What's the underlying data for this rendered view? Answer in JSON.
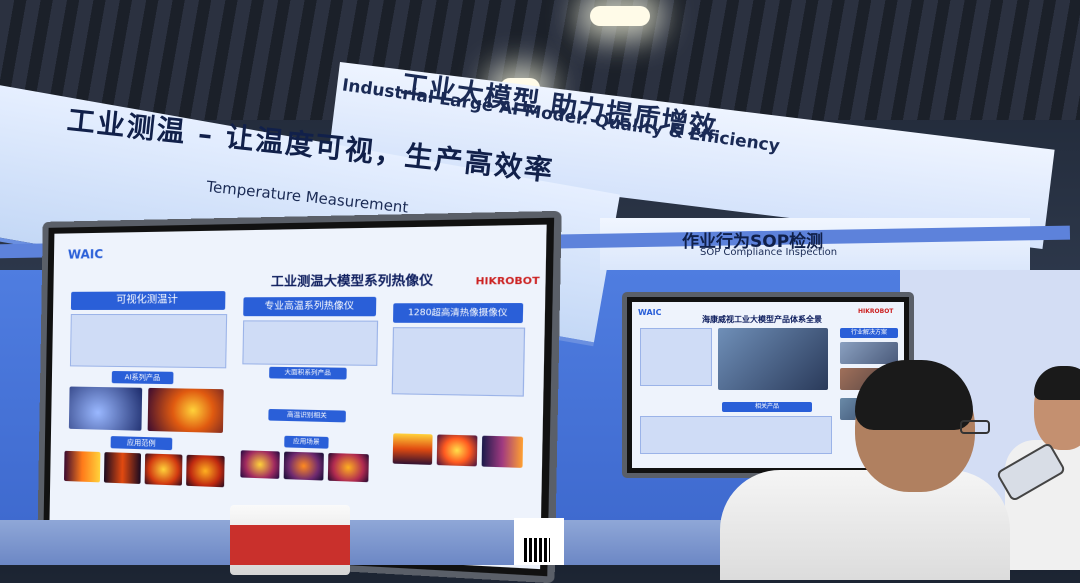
{
  "banner": {
    "title_cn": "工业大模型  助力提质增效",
    "title_en": "Industrial Large AI Model: Quality & Efficiency",
    "temperature_cn": "工业测温 – 让温度可视，生产高效率",
    "temperature_en": "Temperature Measurement",
    "sop_cn": "作业行为SOP检测",
    "sop_en": "SOP Compliance Inspection"
  },
  "left_screen": {
    "logo": "WAIC",
    "brand": "HIKROBOT",
    "title": "工业测温大模型系列热像仪",
    "section_visual": "可视化测温计",
    "section_ai": "AI系列产品",
    "section_pro": "专业高温系列热像仪",
    "section_1280": "1280超高清热像摄像仪",
    "label_big_panel": "大面积系列产品",
    "label_high_temp": "高温识别相关",
    "label_apps": "应用场景",
    "label_cases": "应用范例"
  },
  "right_screen": {
    "logo": "WAIC",
    "brand": "HIKROBOT",
    "title": "海康威视工业大模型产品体系全景",
    "section_right": "行业解决方案",
    "section_products": "相关产品"
  },
  "colors": {
    "banner_text": "#1a2a55",
    "accent_blue": "#2a5fd8",
    "wall_blue": "#4f7de0"
  }
}
